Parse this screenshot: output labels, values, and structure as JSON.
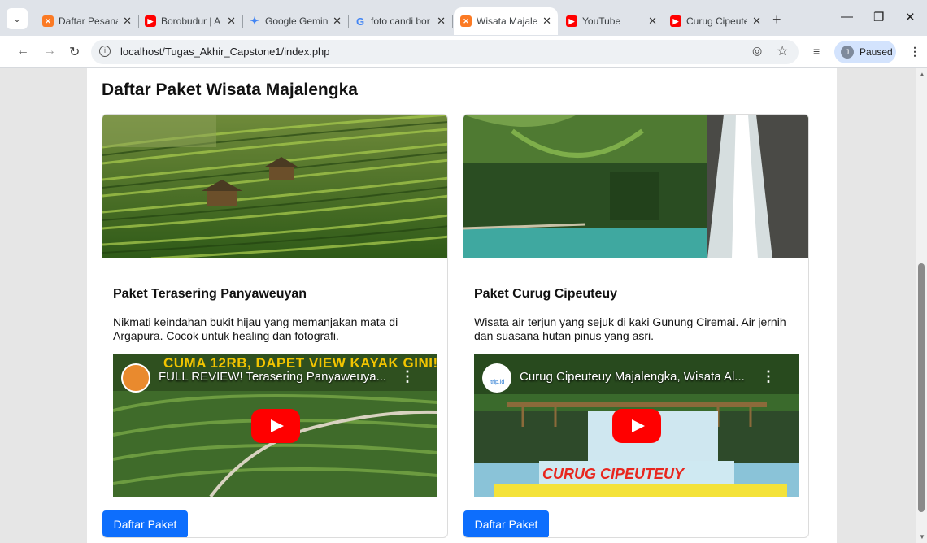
{
  "browser": {
    "tabs": [
      {
        "title": "Daftar Pesanan",
        "favicon": "xampp-icon",
        "active": false
      },
      {
        "title": "Borobudur | A",
        "favicon": "youtube-icon",
        "active": false
      },
      {
        "title": "Google Gemini",
        "favicon": "gemini-icon",
        "active": false
      },
      {
        "title": "foto candi bor",
        "favicon": "google-icon",
        "active": false
      },
      {
        "title": "Wisata Majale",
        "favicon": "xampp-icon",
        "active": true
      },
      {
        "title": "YouTube",
        "favicon": "youtube-icon",
        "active": false
      },
      {
        "title": "Curug Cipeute",
        "favicon": "youtube-icon",
        "active": false
      }
    ],
    "url": "localhost/Tugas_Akhir_Capstone1/index.php",
    "profile_label": "Paused",
    "profile_initial": "J"
  },
  "page": {
    "title": "Daftar Paket Wisata Majalengka",
    "packages": [
      {
        "name": "Paket Terasering Panyaweuyan",
        "description": "Nikmati keindahan bukit hijau yang memanjakan mata di Argapura. Cocok untuk healing dan fotografi.",
        "video_title": "FULL REVIEW! Terasering Panyaweuya...",
        "video_overlay_text": "CUMA 12RB, DAPET VIEW KAYAK GINI!",
        "button_label": "Daftar Paket"
      },
      {
        "name": "Paket Curug Cipeuteuy",
        "description": "Wisata air terjun yang sejuk di kaki Gunung Ciremai. Air jernih dan suasana hutan pinus yang asri.",
        "video_title": "Curug Cipeuteuy Majalengka, Wisata Al...",
        "video_overlay_text": "CURUG CIPEUTEUY",
        "video_channel_label": "itrip.id",
        "button_label": "Daftar Paket"
      }
    ]
  },
  "colors": {
    "button": "#0d6efd",
    "play": "#ff0000",
    "profile_bg": "#d3e3fd"
  }
}
